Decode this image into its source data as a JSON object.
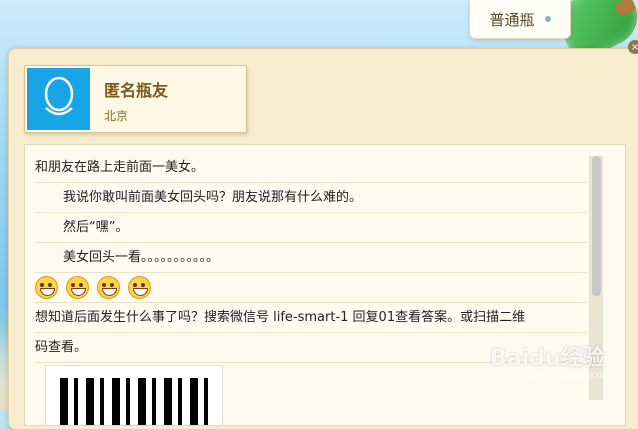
{
  "tab": {
    "label": "普通瓶"
  },
  "user": {
    "name": "匿名瓶友",
    "city": "北京"
  },
  "message": {
    "lines": [
      "和朋友在路上走前面一美女。",
      "我说你敢叫前面美女回头吗？朋友说那有什么难的。",
      "然后“嘿”。",
      "美女回头一看。。。。。。。。。。。",
      "想知道后面发生什么事了吗？搜索微信号  life-smart-1  回复01查看答案。或扫描二维",
      "码查看。"
    ],
    "emoji_count": 4
  },
  "watermark": {
    "text": "Baidu经验",
    "sub": "jingyan.baidu.com"
  },
  "colors": {
    "panel_bg": "#f7ecce",
    "avatar_bg": "#1aa4e8",
    "name_color": "#7a5a1f"
  }
}
